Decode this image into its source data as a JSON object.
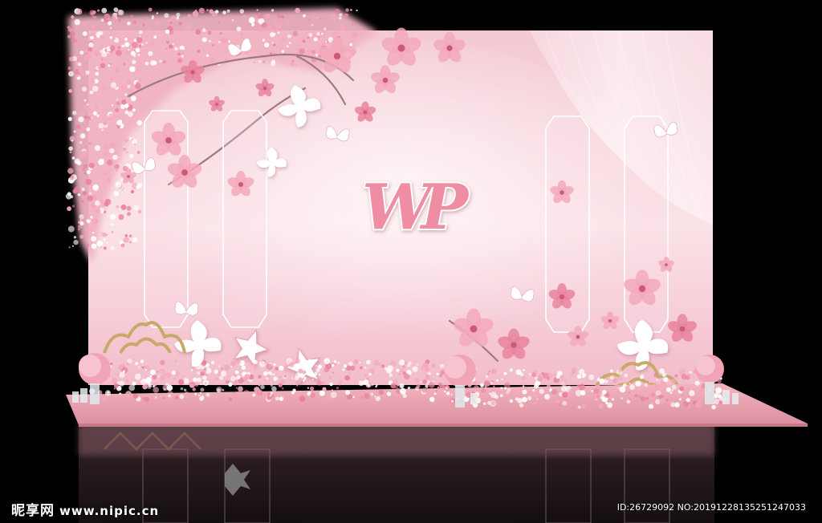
{
  "monogram": {
    "text": "WP"
  },
  "watermark": {
    "brand": "昵享网",
    "site": "www.nipic.cn",
    "id_text": "ID:26729092 NO:20191228135251247033"
  },
  "colors": {
    "background": "#000000",
    "wall": "#f6d3dc",
    "wall_light": "#fbe6ea",
    "blossom": "#f3a9bb",
    "blossom_deep": "#e8849d",
    "stage": "#e9a0ac",
    "gold": "#c9a96a",
    "white": "#ffffff"
  }
}
